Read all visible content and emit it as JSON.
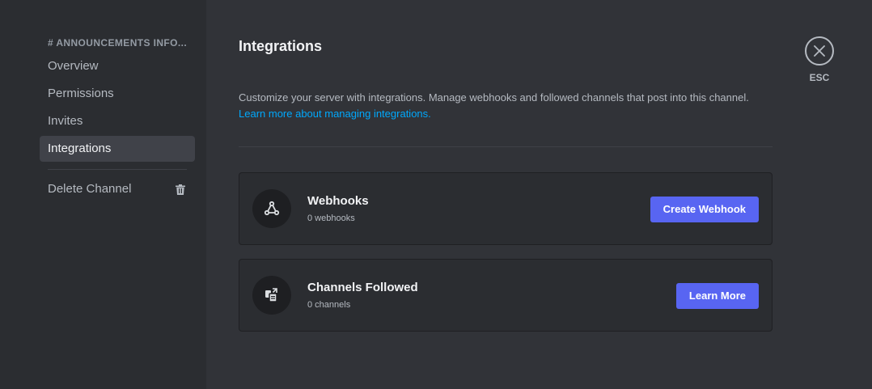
{
  "sidebar": {
    "header": "# ANNOUNCEMENTS INFO...",
    "items": [
      {
        "label": "Overview"
      },
      {
        "label": "Permissions"
      },
      {
        "label": "Invites"
      },
      {
        "label": "Integrations",
        "active": true
      }
    ],
    "delete_label": "Delete Channel"
  },
  "main": {
    "title": "Integrations",
    "description": "Customize your server with integrations. Manage webhooks and followed channels that post into this channel.",
    "learn_link": "Learn more about managing integrations.",
    "cards": [
      {
        "title": "Webhooks",
        "subtitle": "0 webhooks",
        "button": "Create Webhook",
        "icon": "webhook-icon"
      },
      {
        "title": "Channels Followed",
        "subtitle": "0 channels",
        "button": "Learn More",
        "icon": "channel-follow-icon"
      }
    ]
  },
  "close": {
    "label": "ESC"
  },
  "colors": {
    "accent": "#5865f2",
    "link": "#00a8fc",
    "active_bg": "#404249"
  }
}
